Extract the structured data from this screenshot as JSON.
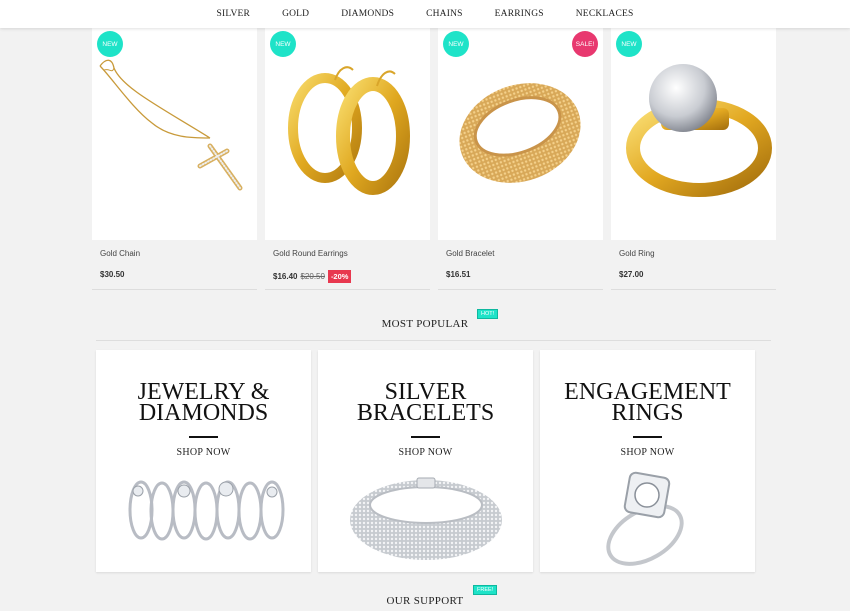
{
  "nav": {
    "items": [
      "SILVER",
      "GOLD",
      "DIAMONDS",
      "CHAINS",
      "EARRINGS",
      "NECKLACES"
    ]
  },
  "products": [
    {
      "name": "Gold Chain",
      "price": "$30.50",
      "badge": "NEW"
    },
    {
      "name": "Gold Round Earrings",
      "price": "$16.40",
      "old_price": "$20.50",
      "discount": "-20%",
      "badge": "NEW"
    },
    {
      "name": "Gold Bracelet",
      "price": "$16.51",
      "badge": "NEW",
      "badge2": "SALE!"
    },
    {
      "name": "Gold Ring",
      "price": "$27.00",
      "badge": "NEW"
    }
  ],
  "most_popular": {
    "title": "MOST POPULAR",
    "tag": "HOT!"
  },
  "categories": [
    {
      "line1": "JEWELRY &",
      "line2": "DIAMONDS",
      "cta": "SHOP NOW"
    },
    {
      "line1": "SILVER",
      "line2": "BRACELETS",
      "cta": "SHOP NOW"
    },
    {
      "line1": "ENGAGEMENT",
      "line2": "RINGS",
      "cta": "SHOP NOW"
    }
  ],
  "support": {
    "title": "OUR SUPPORT",
    "tag": "FREE!"
  },
  "colors": {
    "badge_new": "#1ee3c8",
    "badge_sale": "#e8386f",
    "discount": "#e8384f"
  }
}
